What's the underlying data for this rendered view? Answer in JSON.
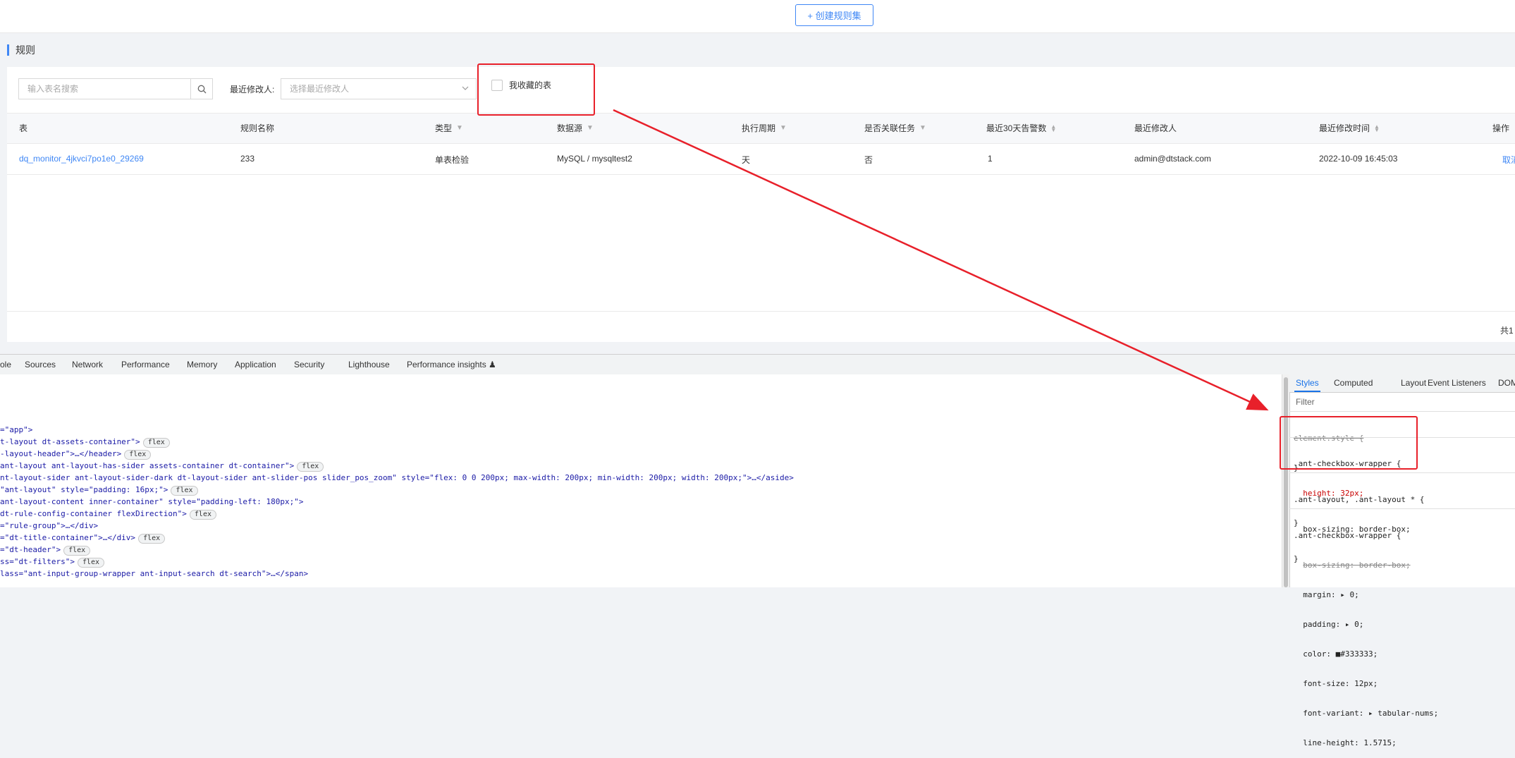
{
  "top": {
    "create_button": "+ 创建规则集"
  },
  "section": {
    "title": "规则"
  },
  "filters": {
    "search_placeholder": "输入表名搜索",
    "modifier_label": "最近修改人:",
    "modifier_placeholder": "选择最近修改人",
    "favorites_label": "我收藏的表"
  },
  "table": {
    "columns": [
      "表",
      "规则名称",
      "类型",
      "数据源",
      "执行周期",
      "是否关联任务",
      "最近30天告警数",
      "最近修改人",
      "最近修改时间",
      "操作"
    ],
    "rows": [
      {
        "table": "dq_monitor_4jkvci7po1e0_29269",
        "rule_name": "233",
        "type": "单表检验",
        "datasource": "MySQL / mysqltest2",
        "period": "天",
        "linked_task": "否",
        "alerts_30d": "1",
        "modifier": "admin@dtstack.com",
        "modified_time": "2022-10-09 16:45:03",
        "action": "取消"
      }
    ],
    "pager_text": "共1"
  },
  "devtools": {
    "tabs": [
      "ole",
      "Sources",
      "Network",
      "Performance",
      "Memory",
      "Application",
      "Security",
      "Lighthouse",
      "Performance insights ♟"
    ],
    "badge_flex": "flex",
    "styles_tabs": [
      "Styles",
      "Computed",
      "Layout",
      "Event Listeners",
      "DOM"
    ],
    "filter_placeholder": "Filter",
    "code_lines": [
      "=\"app\">",
      "t-layout dt-assets-container\">",
      "-layout-header\">…</header>",
      "ant-layout ant-layout-has-sider assets-container dt-container\">",
      "nt-layout-sider ant-layout-sider-dark dt-layout-sider ant-slider-pos slider_pos_zoom\" style=\"flex: 0 0 200px; max-width: 200px; min-width: 200px; width: 200px;\">…</aside>",
      "\"ant-layout\" style=\"padding: 16px;\">",
      "ant-layout-content inner-container\" style=\"padding-left: 180px;\">",
      "dt-rule-config-container flexDirection\">",
      "=\"rule-group\">…</div>",
      "=\"dt-title-container\">…</div>",
      "=\"dt-header\">",
      "ss=\"dt-filters\">",
      "lass=\"ant-input-group-wrapper ant-input-search dt-search\">…</span>"
    ],
    "css": {
      "element_style": "element.style {",
      "close": "}",
      "rule1_selector": ".ant-checkbox-wrapper {",
      "rule1_prop": "height: 32px;",
      "rule2_selector": ".ant-layout, .ant-layout * {",
      "rule2_prop": "box-sizing: border-box;",
      "rule3_selector": ".ant-checkbox-wrapper {",
      "rule3_props": [
        "box-sizing: border-box;",
        "margin: ▸ 0;",
        "padding: ▸ 0;",
        "color: ■#333333;",
        "font-size: 12px;",
        "font-variant: ▸ tabular-nums;",
        "line-height: 1.5715;"
      ]
    }
  },
  "colors": {
    "accent": "#3f87f5",
    "annotation": "#e8202a"
  }
}
